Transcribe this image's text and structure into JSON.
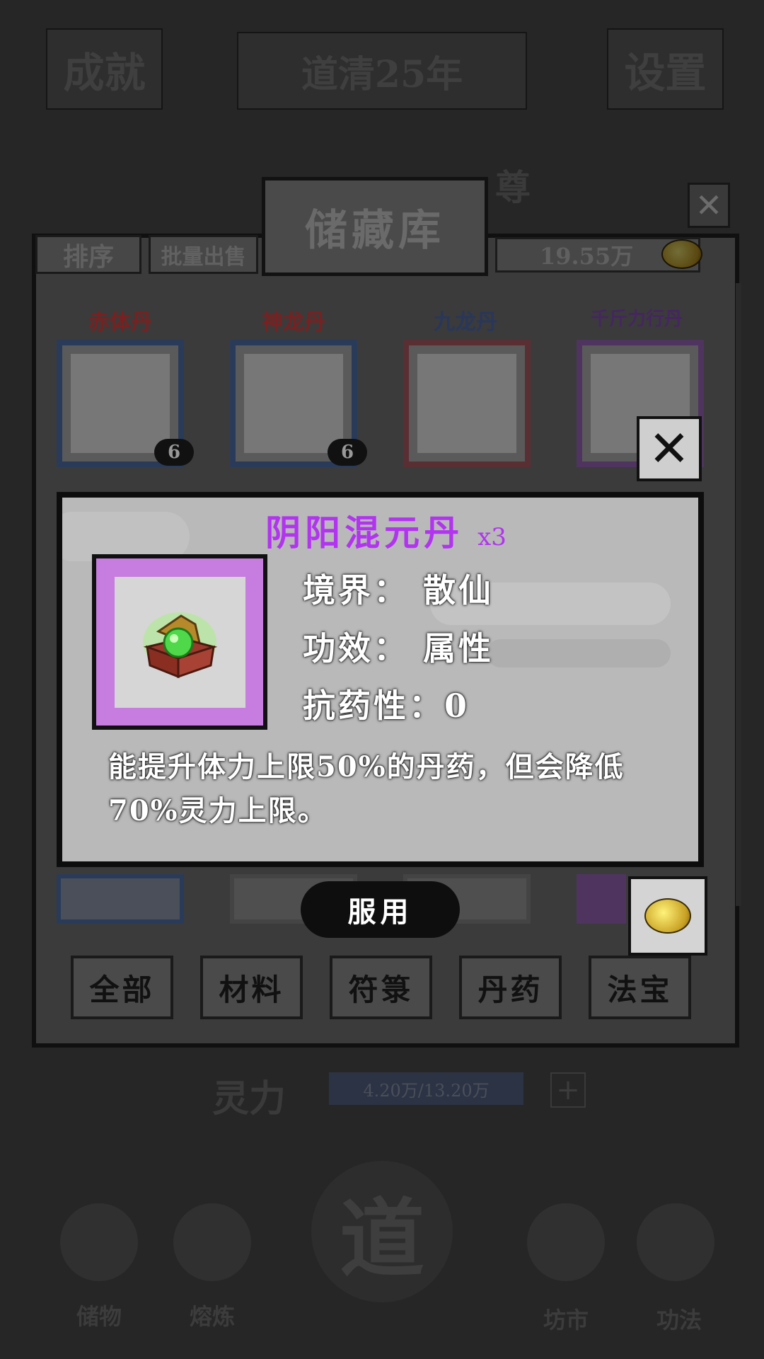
{
  "top_bar": {
    "achievement": "成就",
    "era": "道清25年",
    "settings": "设置"
  },
  "sect_banner": "尊",
  "storage": {
    "title": "储藏库",
    "sort_tab": "排序",
    "bulk_sell_tab": "批量出售",
    "money": "19.55万",
    "items": [
      {
        "name": "赤体丹",
        "name_color": "#8a2222",
        "count": "6"
      },
      {
        "name": "神龙丹",
        "name_color": "#8a2222",
        "count": "6"
      },
      {
        "name": "九龙丹",
        "name_color": "#2b3f6e",
        "count": ""
      },
      {
        "name": "千斤力行丹",
        "name_color": "#4d2a6e",
        "count": ""
      }
    ],
    "filters": [
      "全部",
      "材料",
      "符箓",
      "丹药",
      "法宝"
    ]
  },
  "detail": {
    "name": "阴阳混元丹",
    "quantity": "x3",
    "realm_label": "境界：",
    "realm_value": "散仙",
    "effect_label": "功效：",
    "effect_value": "属性",
    "resistance_label": "抗药性：",
    "resistance_value": "0",
    "description": "能提升体力上限50%的丹药，但会降低70%灵力上限。",
    "use_button": "服用",
    "rarity_color": "#b233f0"
  },
  "status": {
    "spirit_label": "灵力",
    "spirit_value": "4.20万/13.20万"
  },
  "bottom_nav": [
    "储物",
    "熔炼",
    "道",
    "坊市",
    "功法"
  ]
}
